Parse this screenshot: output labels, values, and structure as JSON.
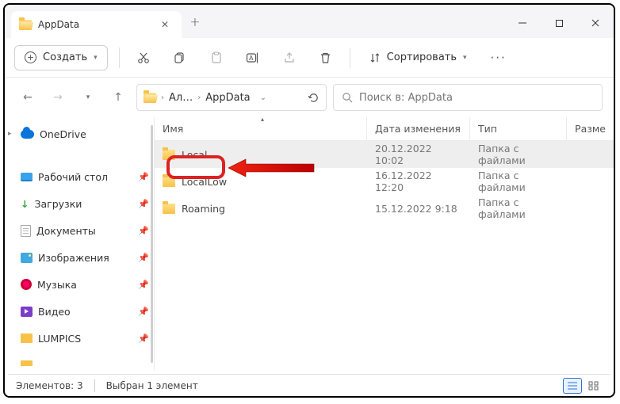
{
  "window": {
    "title": "AppData"
  },
  "toolbar": {
    "create_label": "Создать",
    "sort_label": "Сортировать"
  },
  "breadcrumb": {
    "part1": "Ал…",
    "part2": "AppData"
  },
  "search": {
    "placeholder": "Поиск в: AppData"
  },
  "sidebar": {
    "onedrive": "OneDrive",
    "items": [
      {
        "label": "Рабочий стол"
      },
      {
        "label": "Загрузки"
      },
      {
        "label": "Документы"
      },
      {
        "label": "Изображения"
      },
      {
        "label": "Музыка"
      },
      {
        "label": "Видео"
      },
      {
        "label": "LUMPICS"
      }
    ]
  },
  "columns": {
    "name": "Имя",
    "date": "Дата изменения",
    "type": "Тип",
    "size": "Разме"
  },
  "rows": [
    {
      "name": "Local",
      "date": "20.12.2022 10:02",
      "type": "Папка с файлами",
      "selected": true
    },
    {
      "name": "LocalLow",
      "date": "16.12.2022 12:20",
      "type": "Папка с файлами",
      "selected": false
    },
    {
      "name": "Roaming",
      "date": "15.12.2022 9:18",
      "type": "Папка с файлами",
      "selected": false
    }
  ],
  "status": {
    "count": "Элементов: 3",
    "selection": "Выбран 1 элемент"
  }
}
